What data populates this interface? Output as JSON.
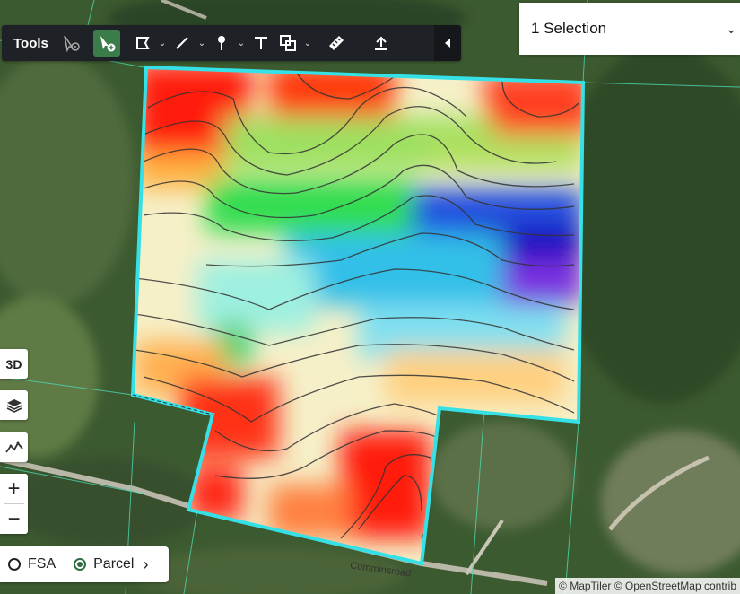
{
  "toolbar": {
    "label": "Tools",
    "tools": [
      {
        "name": "info-pointer-icon",
        "active": false
      },
      {
        "name": "add-select-icon",
        "active": true
      },
      {
        "name": "polygon-icon",
        "active": false,
        "caret": true
      },
      {
        "name": "line-icon",
        "active": false,
        "caret": true
      },
      {
        "name": "pin-icon",
        "active": false,
        "caret": true
      },
      {
        "name": "text-icon",
        "active": false
      },
      {
        "name": "shape-icon",
        "active": false,
        "caret": true
      },
      {
        "name": "ruler-icon",
        "active": false
      },
      {
        "name": "upload-icon",
        "active": false
      }
    ],
    "collapse_icon": "caret-left-icon"
  },
  "selection": {
    "label": "1 Selection",
    "icon": "chevron-down-icon"
  },
  "side_controls": {
    "three_d_label": "3D",
    "layers_icon": "layers-icon",
    "elevation_icon": "elevation-icon",
    "zoom_in": "+",
    "zoom_out": "−"
  },
  "layer_toggle": {
    "options": [
      "FSA",
      "Parcel"
    ],
    "selected": "Parcel",
    "icon": "chevron-right-icon"
  },
  "map": {
    "road_label": "Cumminsroad",
    "attribution": "© MapTiler © OpenStreetMap contrib",
    "parcel_color": "#35e0e6"
  }
}
